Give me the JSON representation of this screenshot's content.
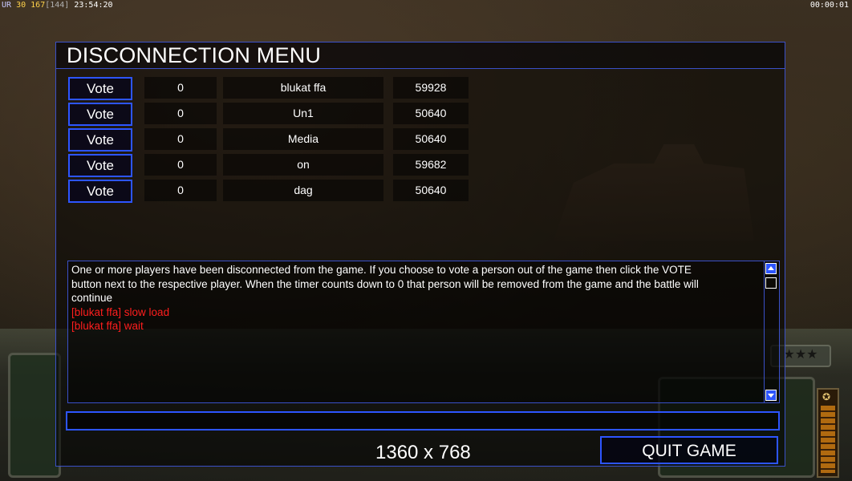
{
  "hud": {
    "ur": "UR",
    "v30": "30",
    "v167": "167",
    "v144": "[144]",
    "clock": "23:54:20",
    "timer": "00:00:01"
  },
  "dialog": {
    "title": "DISCONNECTION MENU",
    "players": [
      {
        "vote_label": "Vote",
        "count": "0",
        "name": "blukat ffa",
        "ping": "59928"
      },
      {
        "vote_label": "Vote",
        "count": "0",
        "name": "Un1",
        "ping": "50640"
      },
      {
        "vote_label": "Vote",
        "count": "0",
        "name": "Media",
        "ping": "50640"
      },
      {
        "vote_label": "Vote",
        "count": "0",
        "name": "on",
        "ping": "59682"
      },
      {
        "vote_label": "Vote",
        "count": "0",
        "name": "dag",
        "ping": "50640"
      }
    ],
    "message": {
      "info": "One or more players have been disconnected from the game. If you choose to vote a person out of the game then click the VOTE",
      "info2": " button next to the respective player. When the timer counts down to 0 that person will be removed from the game and the battle will",
      "info3": " continue",
      "chat": [
        "[blukat ffa] slow load",
        "[blukat ffa] wait"
      ]
    },
    "chat_input_value": "",
    "resolution": "1360 x 768",
    "quit_label": "QUIT GAME"
  },
  "colors": {
    "accent_blue": "#2d55ff",
    "chat_red": "#ff1e1e"
  }
}
